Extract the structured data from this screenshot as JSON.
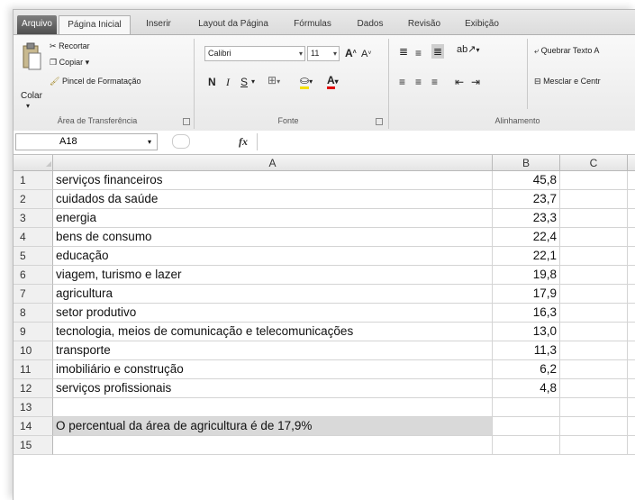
{
  "tabs": [
    "Arquivo",
    "Página Inicial",
    "Inserir",
    "Layout da Página",
    "Fórmulas",
    "Dados",
    "Revisão",
    "Exibição"
  ],
  "ribbon": {
    "clipboard": {
      "paste": "Colar",
      "cut": "Recortar",
      "copy": "Copiar ▾",
      "format_painter": "Pincel de Formatação",
      "group_label": "Área de Transferência"
    },
    "font": {
      "font_name": "Calibri",
      "font_size": "11",
      "bold": "N",
      "italic": "I",
      "underline": "S",
      "group_label": "Fonte"
    },
    "alignment": {
      "wrap_text": "Quebrar Texto A",
      "merge_center": "Mesclar e Centr",
      "group_label": "Alinhamento"
    }
  },
  "formula_bar": {
    "name_box": "A18",
    "fx": "fx",
    "formula": ""
  },
  "columns": [
    "A",
    "B",
    "C"
  ],
  "rows": [
    {
      "num": "1",
      "a": "serviços financeiros",
      "b": "45,8"
    },
    {
      "num": "2",
      "a": "cuidados da saúde",
      "b": "23,7"
    },
    {
      "num": "3",
      "a": "energia",
      "b": "23,3"
    },
    {
      "num": "4",
      "a": "bens de consumo",
      "b": "22,4"
    },
    {
      "num": "5",
      "a": "educação",
      "b": "22,1"
    },
    {
      "num": "6",
      "a": "viagem, turismo e lazer",
      "b": "19,8"
    },
    {
      "num": "7",
      "a": "agricultura",
      "b": "17,9"
    },
    {
      "num": "8",
      "a": "setor produtivo",
      "b": "16,3"
    },
    {
      "num": "9",
      "a": "tecnologia, meios de comunicação e telecomunicações",
      "b": "13,0"
    },
    {
      "num": "10",
      "a": "transporte",
      "b": "11,3"
    },
    {
      "num": "11",
      "a": "imobiliário e construção",
      "b": "6,2"
    },
    {
      "num": "12",
      "a": "serviços profissionais",
      "b": "4,8"
    },
    {
      "num": "13",
      "a": "",
      "b": ""
    },
    {
      "num": "14",
      "a": "O percentual da área de agricultura  é de 17,9%",
      "b": ""
    },
    {
      "num": "15",
      "a": "",
      "b": ""
    }
  ],
  "colors": {
    "file_tab": "#5f5f5f",
    "highlight_cell": "#d9d9d9"
  }
}
